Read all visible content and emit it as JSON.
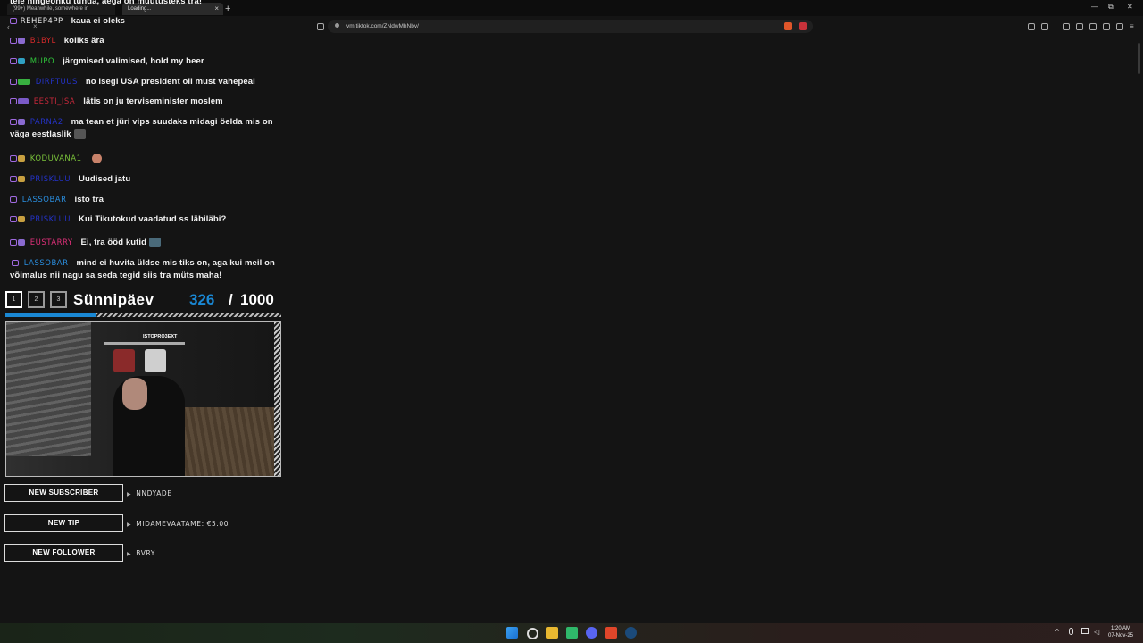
{
  "browser": {
    "tabs": [
      {
        "label": "(99+) Meanwhile, somewhere in"
      },
      {
        "label": "Loading..."
      }
    ],
    "new_tab": "+",
    "window_controls": [
      "—",
      "⧉",
      "✕"
    ],
    "url": "vm.tiktok.com/ZNdwMhNbv/"
  },
  "chat": {
    "top_partial": "teie hingeohku tunda, aega on muutusteks tra!",
    "messages": [
      {
        "user": "REHEP4PP",
        "user_color": "#e8e8e8",
        "text": "kaua ei oleks"
      },
      {
        "user": "B1BYL",
        "user_color": "#d42a2a",
        "text": "koliks ära"
      },
      {
        "user": "MUPO",
        "user_color": "#2fc23a",
        "text": "järgmised valimised, hold my beer"
      },
      {
        "user": "DIRPTUUS",
        "user_color": "#2433c9",
        "text": "no isegi USA president oli must vahepeal"
      },
      {
        "user": "EESTI_ISA",
        "user_color": "#c4283a",
        "text": "lätis on ju terviseminister moslem"
      },
      {
        "user": "PARNA2",
        "user_color": "#2433c9",
        "text": "ma tean et jüri vips suudaks midagi öelda mis on väga eestlaslik"
      },
      {
        "user": "KODUVANA1",
        "user_color": "#7ac23a",
        "text": ""
      },
      {
        "user": "PRISKLUU",
        "user_color": "#2433c9",
        "text": "Uudised jatu"
      },
      {
        "user": "LASSOBAR",
        "user_color": "#2a8fe0",
        "text": "isto tra"
      },
      {
        "user": "PRISKLUU",
        "user_color": "#2433c9",
        "text": "Kui Tikutokud vaadatud ss läbiläbi?"
      },
      {
        "user": "EUSTARRY",
        "user_color": "#e0307a",
        "text": "Ei, tra ööd kutid"
      },
      {
        "user": "LASSOBAR",
        "user_color": "#2a8fe0",
        "text": "mind ei huvita üldse mis tiks on, aga kui meil on võimalus nii nagu sa seda tegid siis tra müts maha!"
      }
    ]
  },
  "goal": {
    "steps": [
      "1",
      "2",
      "3"
    ],
    "title": "Sünnipäev",
    "current": "326",
    "separator": "/",
    "target": "1000",
    "progress_fraction": 0.326,
    "accent_color": "#1a88d4"
  },
  "webcam": {
    "tag": "ISTOPRO3EXT"
  },
  "alerts": [
    {
      "label": "NEW SUBSCRIBER",
      "value": "NNDYADE"
    },
    {
      "label": "NEW TIP",
      "value": "MIDAMEVAATAME: €5.00"
    },
    {
      "label": "NEW FOLLOWER",
      "value": "BVRY"
    }
  ],
  "taskbar": {
    "time": "1:20 AM",
    "date": "07-Nov-25"
  }
}
